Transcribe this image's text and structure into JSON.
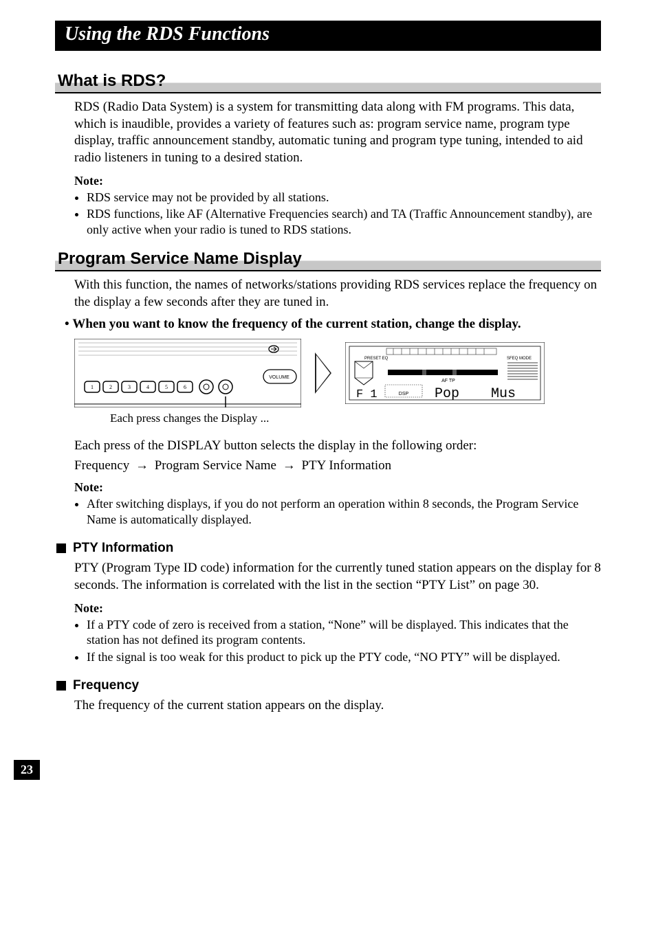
{
  "title": "Using the RDS Functions",
  "sections": {
    "what_is_rds": {
      "heading": "What is RDS?",
      "body": "RDS (Radio Data System) is a system for transmitting data along with FM programs. This data, which is inaudible, provides a variety of features such as: program service name, program type display, traffic announcement standby, automatic tuning and program type tuning, intended to aid radio listeners in tuning to a desired station.",
      "note_label": "Note:",
      "notes": [
        "RDS service may not be provided by all stations.",
        "RDS functions, like AF (Alternative Frequencies search) and TA (Traffic Announcement standby), are only active when your radio is tuned to RDS stations."
      ]
    },
    "psn": {
      "heading": "Program Service Name Display",
      "body": "With this function, the names of networks/stations providing RDS services replace the frequency on the display a few seconds after they are tuned in.",
      "instruction": "When you want to know the frequency of the current station, change the display.",
      "caption": "Each press changes the Display ...",
      "flow_intro": "Each press of the DISPLAY button selects the display in the following order:",
      "flow_items": [
        "Frequency",
        "Program Service Name",
        "PTY Information"
      ],
      "note_label": "Note:",
      "notes": [
        "After switching displays, if you do not perform an operation within 8 seconds, the Program Service Name is automatically displayed."
      ]
    },
    "pty": {
      "heading": "PTY Information",
      "body": "PTY (Program Type ID code) information for the currently tuned station appears on the display for 8 seconds. The information is correlated with the list in the section “PTY List” on page 30.",
      "note_label": "Note:",
      "notes": [
        "If a PTY code of zero is received from a station, “None” will be displayed. This indicates that the station has not defined its program contents.",
        "If the signal is too weak for this product to pick up the PTY code, “NO PTY” will be displayed."
      ]
    },
    "freq": {
      "heading": "Frequency",
      "body": "The frequency of the current station appears on the display."
    }
  },
  "display_panel": {
    "preset_label": "PRESET  EQ",
    "sfeq_label": "SFEQ  MODE",
    "dsp_label": "DSP",
    "af_tp": "AF   TP",
    "f1": "F 1",
    "pop": "Pop",
    "mus": "Mus"
  },
  "device_panel": {
    "volume_label": "VOLUME",
    "buttons": [
      "1",
      "2",
      "3",
      "4",
      "5",
      "6"
    ]
  },
  "page_number": "23"
}
